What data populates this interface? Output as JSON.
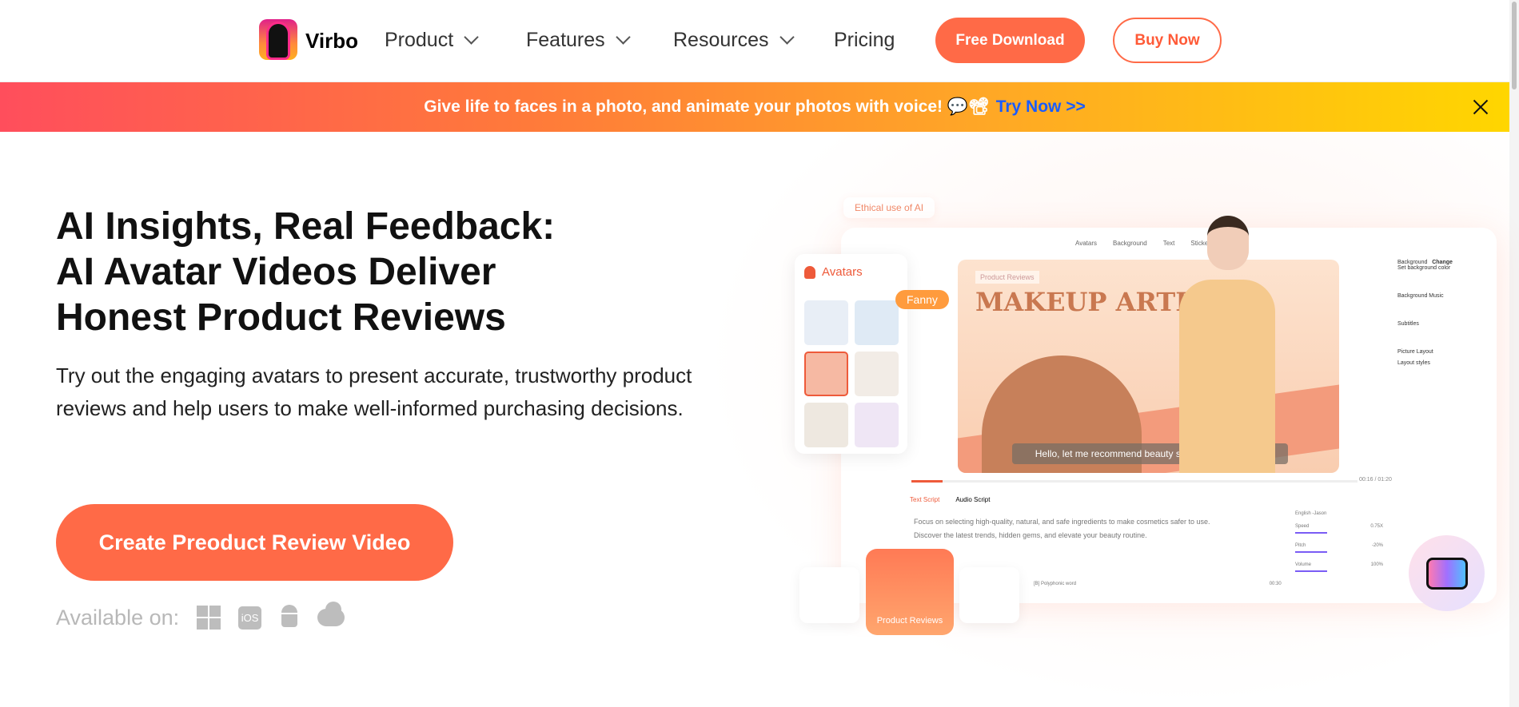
{
  "nav": {
    "brand": "Virbo",
    "items": [
      {
        "label": "Product",
        "dropdown": true
      },
      {
        "label": "Features",
        "dropdown": true
      },
      {
        "label": "Resources",
        "dropdown": true
      },
      {
        "label": "Pricing",
        "dropdown": false
      }
    ],
    "free_download": "Free Download",
    "buy_now": "Buy Now"
  },
  "banner": {
    "text": "Give life to faces in a photo, and animate your photos with voice! 💬📽",
    "link": "Try Now >>"
  },
  "hero": {
    "title_lines": [
      "AI Insights, Real Feedback:",
      "AI Avatar Videos Deliver",
      "Honest Product Reviews"
    ],
    "description": "Try out the engaging avatars to present accurate, trustworthy product reviews and help users to make well-informed purchasing decisions.",
    "cta": "Create Preoduct Review Video",
    "available_on": "Available on:",
    "platforms": [
      "windows-icon",
      "ios-icon",
      "android-icon",
      "cloud-icon"
    ],
    "ios_label": "iOS"
  },
  "mockup": {
    "ethical": "Ethical use of AI",
    "toolbar": [
      "Avatars",
      "Background",
      "Text",
      "Sticker"
    ],
    "avatars_label": "Avatars",
    "avatar_name": "Fanny",
    "video_tag": "Product Reviews",
    "video_title": "MAKEUP ARTIST",
    "caption": "Hello, let me recommend beauty secrets to everyone !",
    "time": "00:16 / 01:20",
    "tabs": [
      "Text Script",
      "Audio Script"
    ],
    "script_lines": [
      "Focus on selecting high-quality, natural, and safe ingredients to make cosmetics safer to use.",
      "Discover the latest trends, hidden gems, and elevate your beauty routine."
    ],
    "settings": [
      "Background",
      "Change",
      "Set background color",
      "Background Music",
      "Subtitles",
      "Picture Layout",
      "Layout styles"
    ],
    "voice": {
      "name": "English -Jason",
      "speed_label": "Speed",
      "speed": "0.75X",
      "pitch_label": "Pitch",
      "pitch": "-20%",
      "volume_label": "Volume",
      "volume": "100%"
    },
    "polyphonic": "[B] Polyphonic word",
    "count": "00:30",
    "card_label": "Product Reviews",
    "progress_percent": 7
  },
  "colors": {
    "accent": "#ff6a47",
    "link": "#1a5cff"
  }
}
